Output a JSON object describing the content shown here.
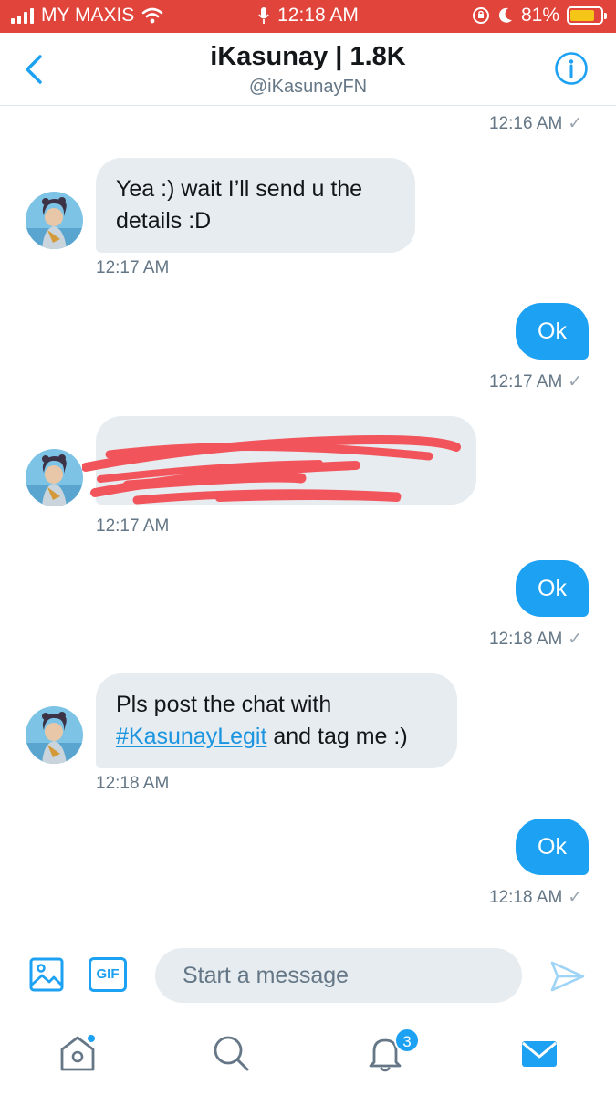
{
  "status_bar": {
    "carrier": "MY MAXIS",
    "time": "12:18 AM",
    "battery": "81%",
    "battery_level": 0.81
  },
  "header": {
    "title": "iKasunay | 1.8K",
    "handle": "@iKasunayFN",
    "back_icon": "chevron-left-icon",
    "info_icon": "info-icon"
  },
  "messages": [
    {
      "direction": "out",
      "time": "12:16 AM",
      "read_check": "✓"
    },
    {
      "direction": "in",
      "text": "Yea :) wait I’ll send u the details :D",
      "line1": "Yea :) wait I’ll send u the",
      "line2": "details :D",
      "time": "12:17 AM"
    },
    {
      "direction": "out",
      "text": "Ok",
      "time": "12:17 AM",
      "read_check": "✓"
    },
    {
      "direction": "in",
      "text": "[redacted email]",
      "time": "12:17 AM",
      "redacted": true
    },
    {
      "direction": "out",
      "text": "Ok",
      "time": "12:18 AM",
      "read_check": "✓"
    },
    {
      "direction": "in",
      "line1": "Pls post the chat with",
      "hashtag": "#KasunayLegit",
      "line2_rest": " and tag me :)",
      "time": "12:18 AM"
    },
    {
      "direction": "out",
      "text": "Ok",
      "time": "12:18 AM",
      "read_check": "✓"
    }
  ],
  "composer": {
    "placeholder": "Start a message",
    "gif_label": "GIF"
  },
  "tabbar": {
    "items": [
      "home-icon",
      "search-icon",
      "notifications-icon",
      "messages-icon"
    ],
    "notification_count": "3"
  },
  "colors": {
    "accent": "#1da1f2",
    "status_bar": "#e0443a",
    "incoming_bubble": "#e6ecf0",
    "redaction": "#f2545b"
  }
}
